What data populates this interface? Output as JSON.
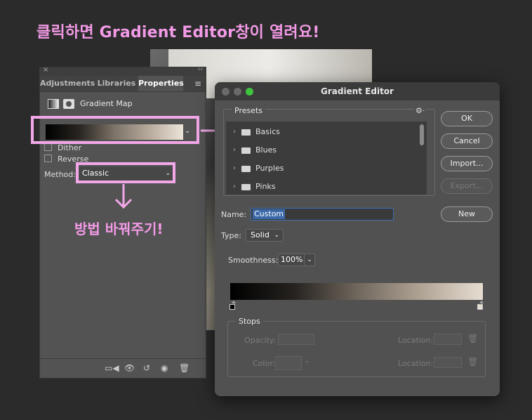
{
  "headline": "클릭하면 Gradient Editor창이 열려요!",
  "properties_panel": {
    "close": "×",
    "collapse": "‹‹",
    "tabs": [
      "Adjustments",
      "Libraries",
      "Properties"
    ],
    "active_tab": "Properties",
    "menu_icon": "≡",
    "adjustment_name": "Gradient Map",
    "gradient_dropdown_chevron": "⌄",
    "dither_label": "Dither",
    "reverse_label": "Reverse",
    "method_label": "Method:",
    "method_value": "Classic",
    "method_chevron": "⌄",
    "footer_icons": [
      "clip-to-layer-icon",
      "view-previous-icon",
      "reset-icon",
      "visibility-icon",
      "delete-icon"
    ]
  },
  "annotation": {
    "note": "방법 바꿔주기!",
    "highlight_color": "#f2a7e8",
    "text_color": "#f29ae6"
  },
  "gradient_editor": {
    "title": "Gradient Editor",
    "presets_label": "Presets",
    "gear_icon": "⚙",
    "presets": [
      "Basics",
      "Blues",
      "Purples",
      "Pinks"
    ],
    "buttons": {
      "ok": "OK",
      "cancel": "Cancel",
      "import": "Import...",
      "export": "Export...",
      "new": "New"
    },
    "name_label": "Name:",
    "name_value": "Custom",
    "type_label": "Type:",
    "type_value": "Solid",
    "smoothness_label": "Smoothness:",
    "smoothness_value": "100%",
    "stops_label": "Stops",
    "opacity_label": "Opacity:",
    "color_label": "Color:",
    "location_label": "Location:"
  }
}
